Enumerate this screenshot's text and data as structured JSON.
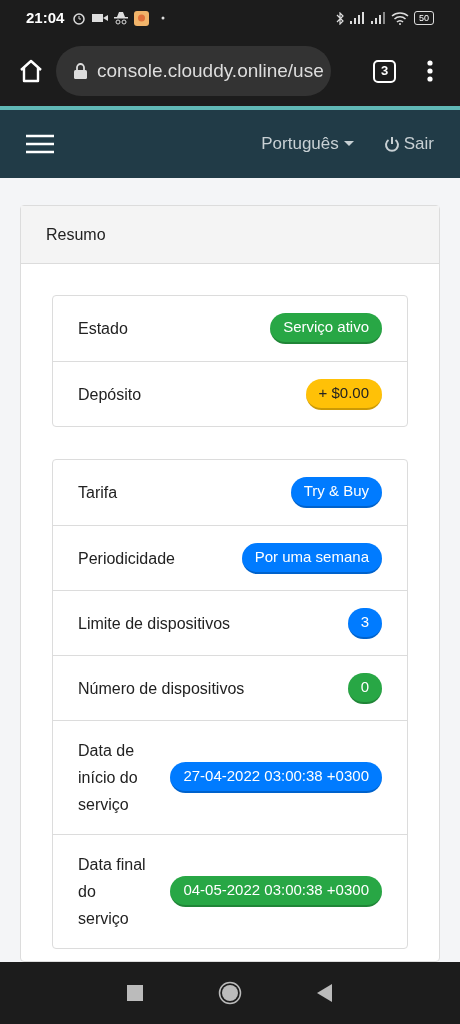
{
  "status_bar": {
    "time": "21:04",
    "battery": "50"
  },
  "browser": {
    "url": "console.clouddy.online/use",
    "tab_count": "3"
  },
  "navbar": {
    "language": "Português",
    "logout": "Sair"
  },
  "card": {
    "title": "Resumo",
    "groups": [
      [
        {
          "label": "Estado",
          "value": "Serviço ativo",
          "color": "#28a745"
        },
        {
          "label": "Depósito",
          "value": "+ $0.00",
          "color": "#ffc107"
        }
      ],
      [
        {
          "label": "Tarifa",
          "value": "Try & Buy",
          "color": "#007bff"
        },
        {
          "label": "Periodicidade",
          "value": "Por uma semana",
          "color": "#007bff"
        },
        {
          "label": "Limite de dispositivos",
          "value": "3",
          "color": "#007bff"
        },
        {
          "label": "Número de dispositivos",
          "value": "0",
          "color": "#28a745"
        },
        {
          "label": "Data de início do serviço",
          "value": "27-04-2022 03:00:38 +0300",
          "color": "#007bff"
        },
        {
          "label": "Data final do serviço",
          "value": "04-05-2022 03:00:38 +0300",
          "color": "#28a745"
        }
      ]
    ]
  }
}
